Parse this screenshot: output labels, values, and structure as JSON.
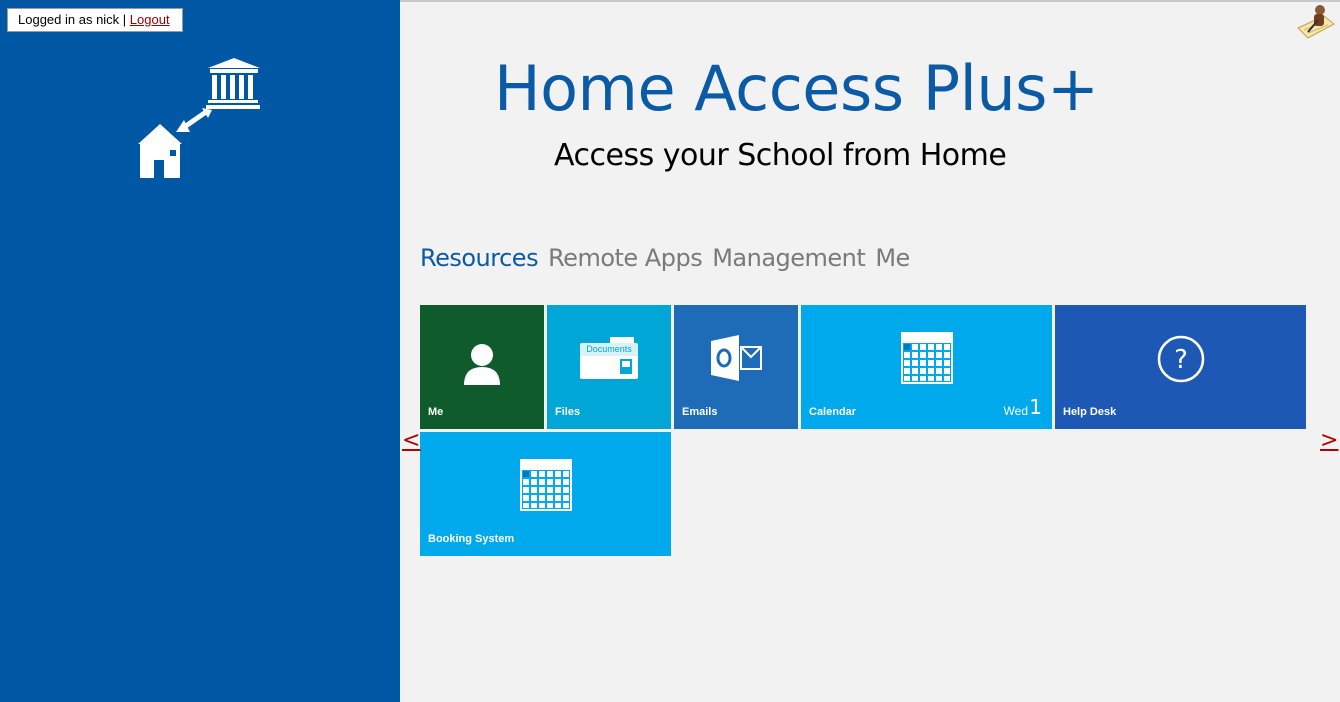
{
  "login": {
    "prefix": "Logged in as nick | ",
    "logout": "Logout"
  },
  "header": {
    "title": "Home Access Plus+",
    "subtitle": "Access your School from Home"
  },
  "tabs": [
    {
      "label": "Resources",
      "active": true
    },
    {
      "label": "Remote Apps",
      "active": false
    },
    {
      "label": "Management",
      "active": false
    },
    {
      "label": "Me",
      "active": false
    }
  ],
  "tiles": {
    "me": {
      "label": "Me",
      "color": "#0f5b2b",
      "icon": "user-icon"
    },
    "files": {
      "label": "Files",
      "color": "#00a7d6",
      "icon": "documents-folder-icon",
      "icon_text": "Documents"
    },
    "emails": {
      "label": "Emails",
      "color": "#1e6bb8",
      "icon": "outlook-icon"
    },
    "calendar": {
      "label": "Calendar",
      "color": "#00a8ec",
      "icon": "calendar-icon",
      "day": "Wed",
      "date": "1"
    },
    "helpdesk": {
      "label": "Help Desk",
      "color": "#1d58b5",
      "icon": "help-icon",
      "icon_text": "?"
    },
    "booking": {
      "label": "Booking System",
      "color": "#00a8ec",
      "icon": "calendar-icon"
    }
  },
  "nav": {
    "prev": "<",
    "next": ">"
  },
  "colors": {
    "sidebar": "#0057a3",
    "accent": "#0b5aa6",
    "background": "#f2f2f2"
  }
}
